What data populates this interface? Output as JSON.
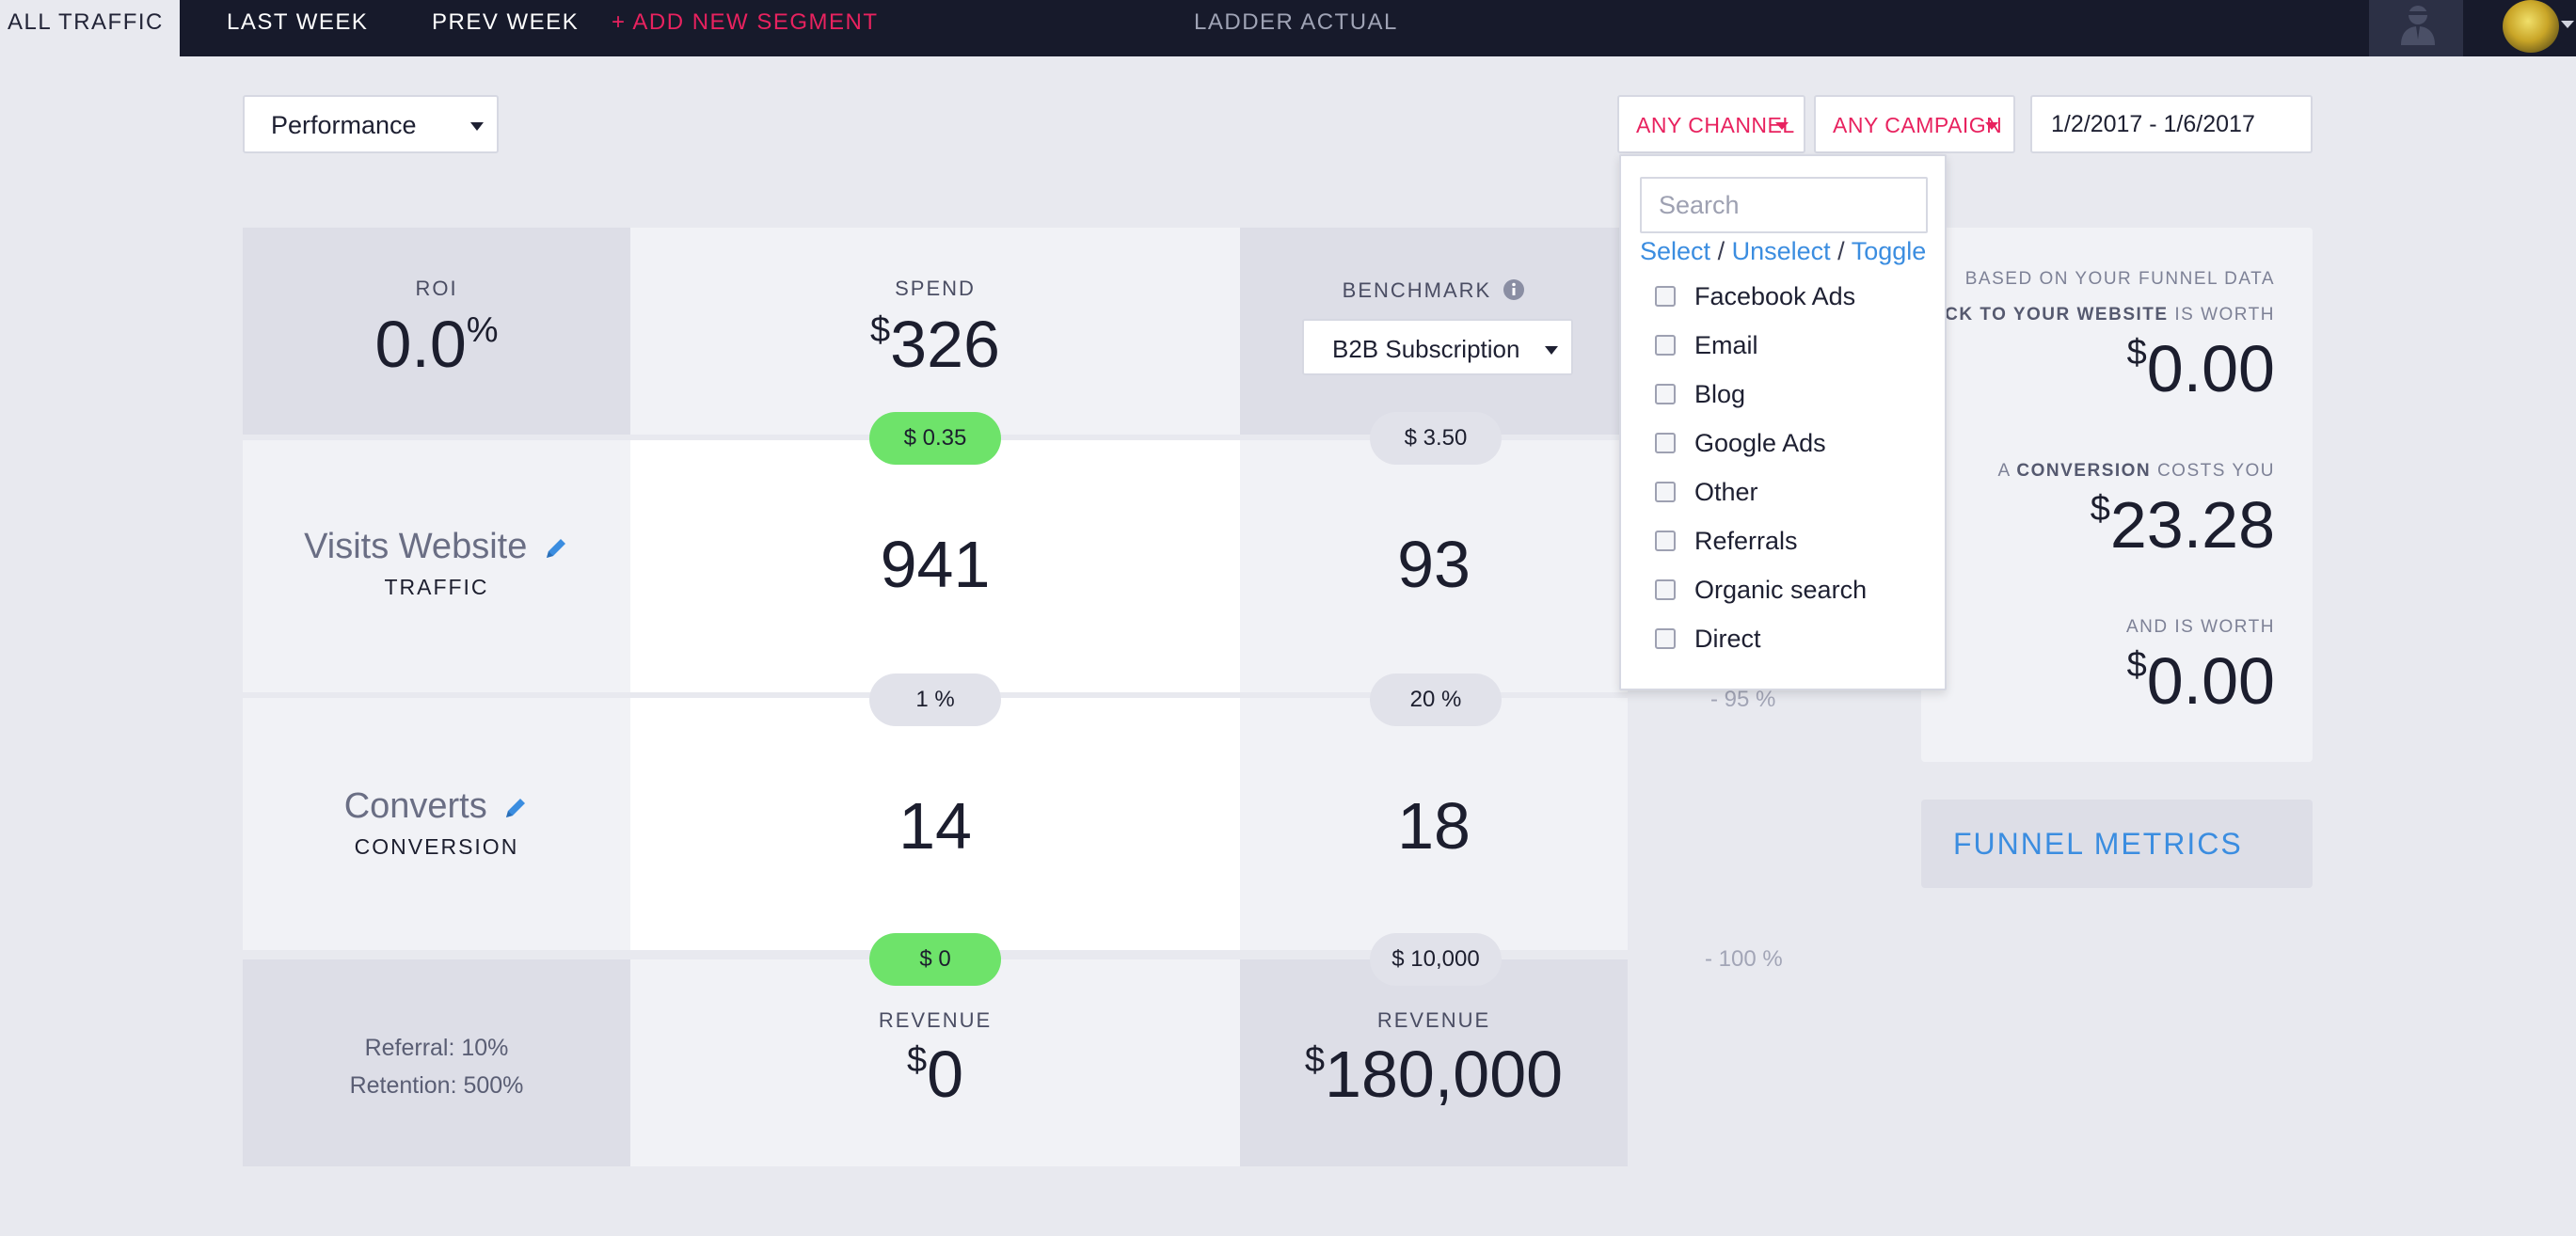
{
  "nav": {
    "tabs": [
      {
        "label": "ALL TRAFFIC",
        "active": true
      },
      {
        "label": "LAST WEEK"
      },
      {
        "label": "PREV WEEK"
      }
    ],
    "add_segment": "+ ADD NEW SEGMENT",
    "center_title": "LADDER ACTUAL"
  },
  "view_select": {
    "value": "Performance"
  },
  "filters": {
    "channel": "ANY CHANNEL",
    "campaign": "ANY CAMPAIGN",
    "date_range": "1/2/2017 - 1/6/2017"
  },
  "channel_dropdown": {
    "search_placeholder": "Search",
    "actions": {
      "select": "Select",
      "unselect": "Unselect",
      "toggle": "Toggle",
      "separator": "/"
    },
    "options": [
      "Facebook Ads",
      "Email",
      "Blog",
      "Google Ads",
      "Other",
      "Referrals",
      "Organic search",
      "Direct"
    ]
  },
  "funnel": {
    "roi": {
      "label": "ROI",
      "value": "0.0",
      "unit": "%"
    },
    "spend": {
      "label": "SPEND",
      "currency": "$",
      "value": "326"
    },
    "benchmark": {
      "label": "BENCHMARK",
      "select_value": "B2B Subscription"
    },
    "cost_per_visit": {
      "actual": "$ 0.35",
      "benchmark": "$ 3.50"
    },
    "step1": {
      "title": "Visits Website",
      "subtitle": "TRAFFIC",
      "actual": "941",
      "benchmark": "93"
    },
    "rate1": {
      "actual": "1 %",
      "benchmark": "20 %",
      "diff": "- 95 %"
    },
    "step2": {
      "title": "Converts",
      "subtitle": "CONVERSION",
      "actual": "14",
      "benchmark": "18"
    },
    "cost_per_conversion": {
      "actual": "$ 0",
      "benchmark": "$ 10,000",
      "diff": "- 100 %"
    },
    "assumptions": {
      "referral": "Referral: 10%",
      "retention": "Retention: 500%"
    },
    "revenue": {
      "label": "REVENUE",
      "currency": "$",
      "actual": "0",
      "benchmark": "180,000"
    }
  },
  "summary": {
    "intro": "BASED ON YOUR FUNNEL DATA",
    "click_prefix": "A",
    "click_bold": "CLICK TO YOUR WEBSITE",
    "click_suffix": "IS WORTH",
    "click_value": "0.00",
    "conversion_prefix": "A",
    "conversion_bold": "CONVERSION",
    "conversion_suffix": "COSTS YOU",
    "conversion_value": "23.28",
    "worth_label": "AND IS WORTH",
    "worth_value": "0.00",
    "currency": "$"
  },
  "funnel_metrics_button": "FUNNEL METRICS",
  "colors": {
    "accent": "#e8225f",
    "link": "#3b8de0",
    "good": "#6ee36a",
    "topbar": "#171a2b"
  },
  "icons": {
    "benchmark_info": "info-icon",
    "edit": "pencil-icon",
    "dropdown": "caret-down-icon"
  }
}
